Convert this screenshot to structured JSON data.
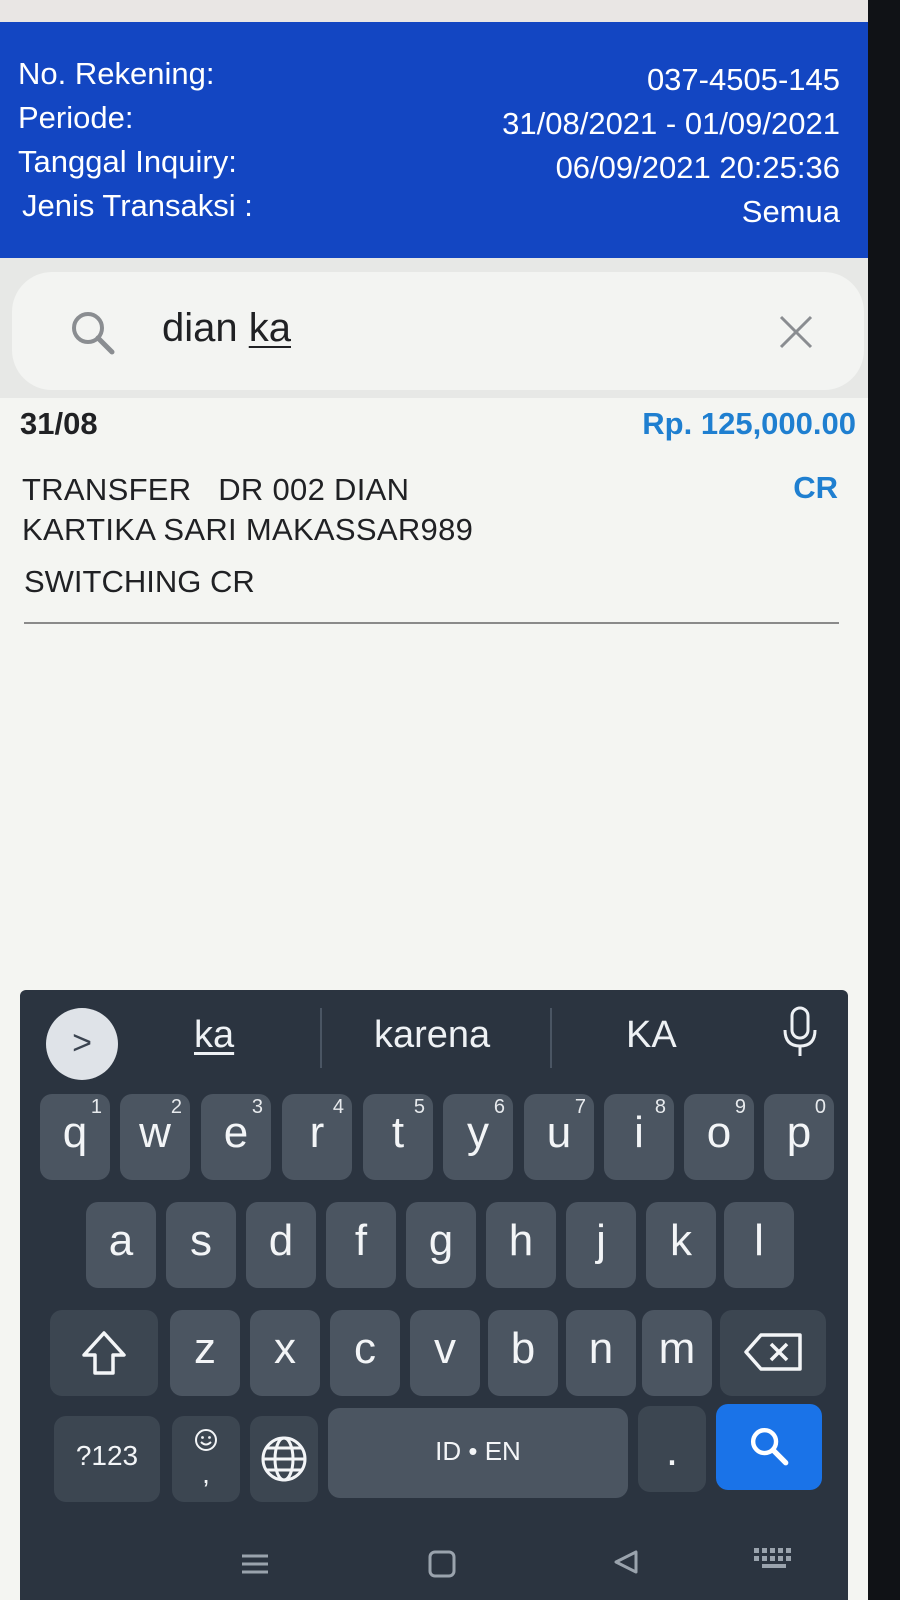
{
  "account": {
    "rows": [
      {
        "label": "No. Rekening:",
        "value": "037-4505-145"
      },
      {
        "label": "Periode:",
        "value": "31/08/2021 - 01/09/2021"
      },
      {
        "label": "Tanggal Inquiry:",
        "value": "06/09/2021 20:25:36"
      },
      {
        "label": "Jenis Transaksi :",
        "value": "Semua"
      }
    ]
  },
  "search": {
    "query_prefix": "dian ",
    "query_composing": "ka"
  },
  "transaction": {
    "date": "31/08",
    "amount": "Rp. 125,000.00",
    "description_line1": "TRANSFER   DR 002 DIAN",
    "description_line2": "KARTIKA SARI MAKASSAR989",
    "type": "CR",
    "code": "SWITCHING CR"
  },
  "keyboard": {
    "expand_glyph": ">",
    "suggestions": [
      "ka",
      "karena",
      "KA"
    ],
    "row1": [
      {
        "ch": "q",
        "sup": "1"
      },
      {
        "ch": "w",
        "sup": "2"
      },
      {
        "ch": "e",
        "sup": "3"
      },
      {
        "ch": "r",
        "sup": "4"
      },
      {
        "ch": "t",
        "sup": "5"
      },
      {
        "ch": "y",
        "sup": "6"
      },
      {
        "ch": "u",
        "sup": "7"
      },
      {
        "ch": "i",
        "sup": "8"
      },
      {
        "ch": "o",
        "sup": "9"
      },
      {
        "ch": "p",
        "sup": "0"
      }
    ],
    "row2": [
      "a",
      "s",
      "d",
      "f",
      "g",
      "h",
      "j",
      "k",
      "l"
    ],
    "row3": [
      "z",
      "x",
      "c",
      "v",
      "b",
      "n",
      "m"
    ],
    "symbols_label": "?123",
    "emoji_comma": ",",
    "space_label": "ID • EN",
    "period_label": ".",
    "icons": {
      "shift": "shift-icon",
      "backspace": "backspace-icon",
      "emoji": "emoji-icon",
      "globe": "globe-icon",
      "search": "search-icon",
      "mic": "microphone-icon"
    },
    "accent_color": "#1a73e8"
  },
  "colors": {
    "header_bg": "#1346c2",
    "amount": "#1f7fd0"
  }
}
